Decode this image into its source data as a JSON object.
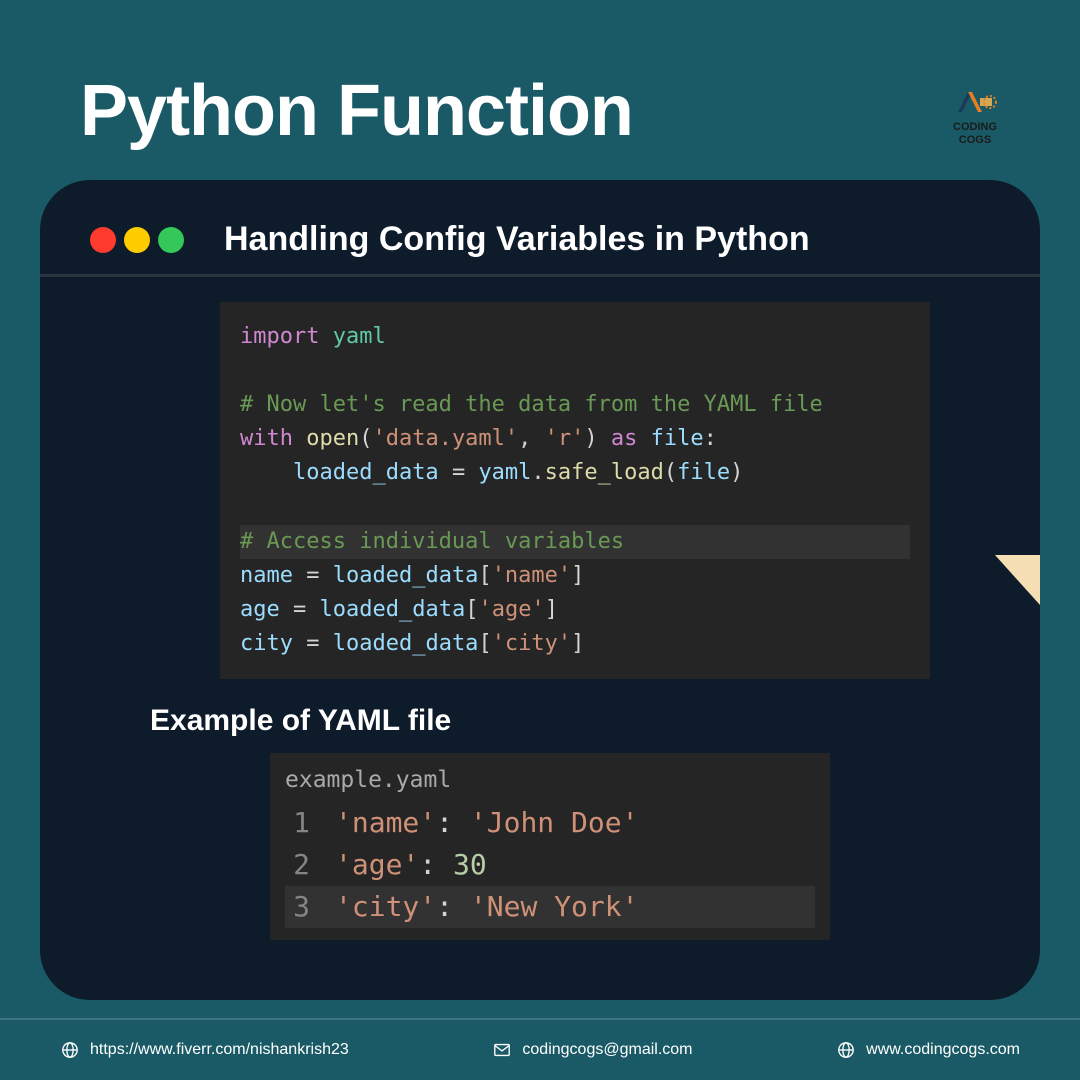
{
  "header": {
    "title": "Python Function",
    "logo_line1": "CODING",
    "logo_line2": "COGS"
  },
  "card": {
    "title": "Handling Config Variables in Python",
    "code": {
      "l1_import": "import",
      "l1_module": "yaml",
      "l3_comment": "# Now let's read the data from the YAML file",
      "l4_with": "with",
      "l4_open": "open",
      "l4_file": "'data.yaml'",
      "l4_mode": "'r'",
      "l4_as": "as",
      "l4_var": "file",
      "l5_var": "loaded_data",
      "l5_yaml": "yaml",
      "l5_func": "safe_load",
      "l5_arg": "file",
      "l7_comment": "# Access individual variables",
      "l8_var": "name",
      "l8_src": "loaded_data",
      "l8_key": "'name'",
      "l9_var": "age",
      "l9_src": "loaded_data",
      "l9_key": "'age'",
      "l10_var": "city",
      "l10_src": "loaded_data",
      "l10_key": "'city'"
    },
    "example_label": "Example of YAML file",
    "yaml": {
      "filename": "example.yaml",
      "rows": [
        {
          "ln": "1",
          "key": "'name'",
          "val": "'John Doe'",
          "is_num": false
        },
        {
          "ln": "2",
          "key": "'age'",
          "val": "30",
          "is_num": true
        },
        {
          "ln": "3",
          "key": "'city'",
          "val": "'New York'",
          "is_num": false
        }
      ]
    }
  },
  "footer": {
    "url1": "https://www.fiverr.com/nishankrish23",
    "email": "codingcogs@gmail.com",
    "url2": "www.codingcogs.com"
  }
}
